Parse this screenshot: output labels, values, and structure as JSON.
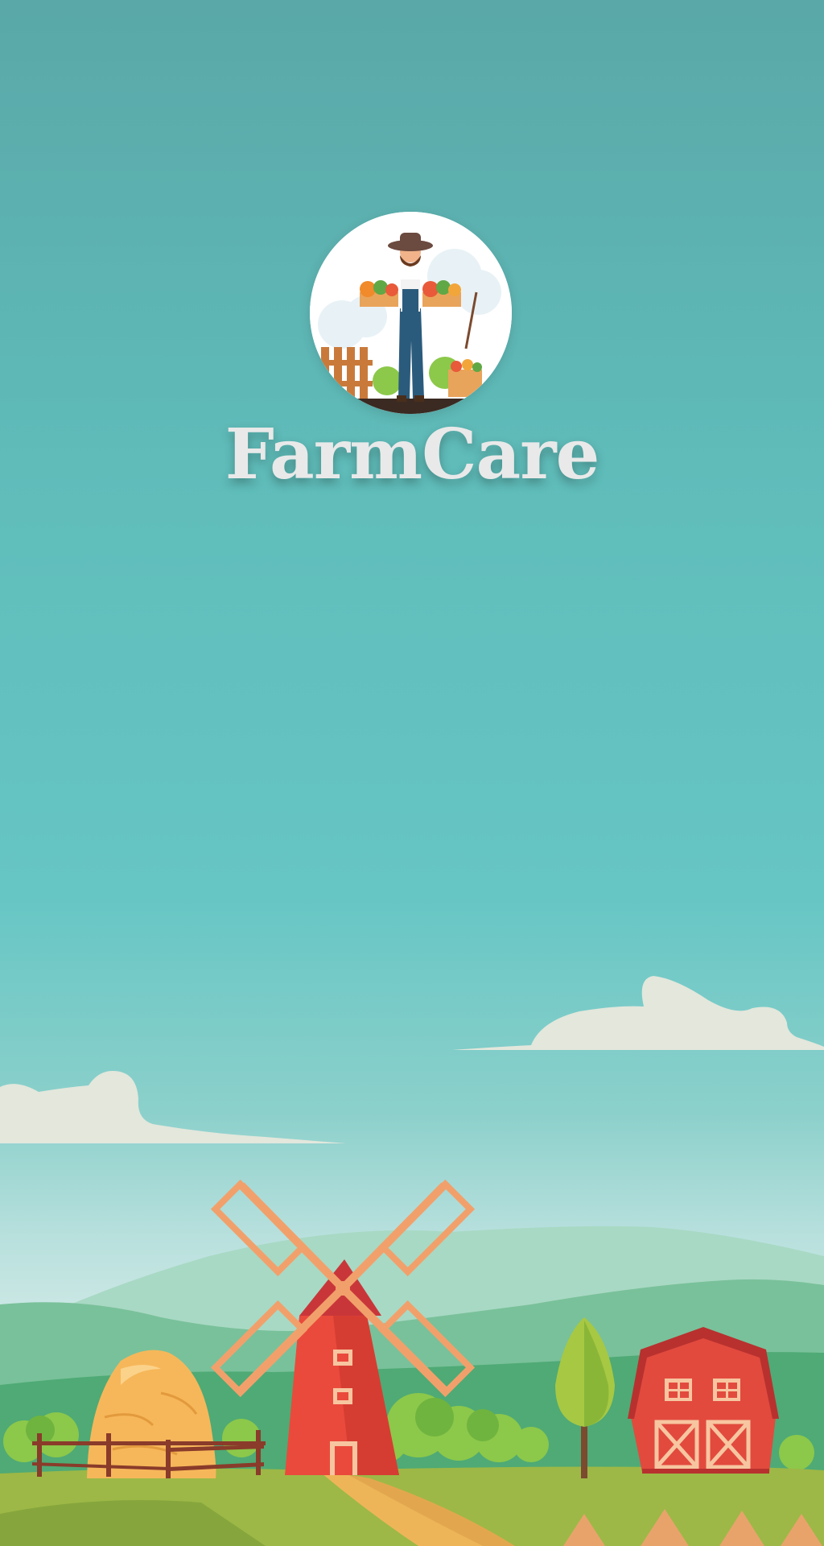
{
  "app": {
    "title": "FarmCare"
  },
  "logo": {
    "icon": "farmer-with-vegetables-icon"
  },
  "scene": {
    "icons": [
      "cloud-icon",
      "windmill-icon",
      "haystack-icon",
      "fence-icon",
      "tree-icon",
      "barn-icon",
      "hills-icon"
    ]
  },
  "colors": {
    "sky_top": "#5aa8a8",
    "sky_mid": "#66c6c4",
    "title": "#e9e9e9",
    "windmill": "#ea4a3c",
    "barn": "#e24a3e",
    "hay": "#f6b75a",
    "grass": "#9db846"
  }
}
